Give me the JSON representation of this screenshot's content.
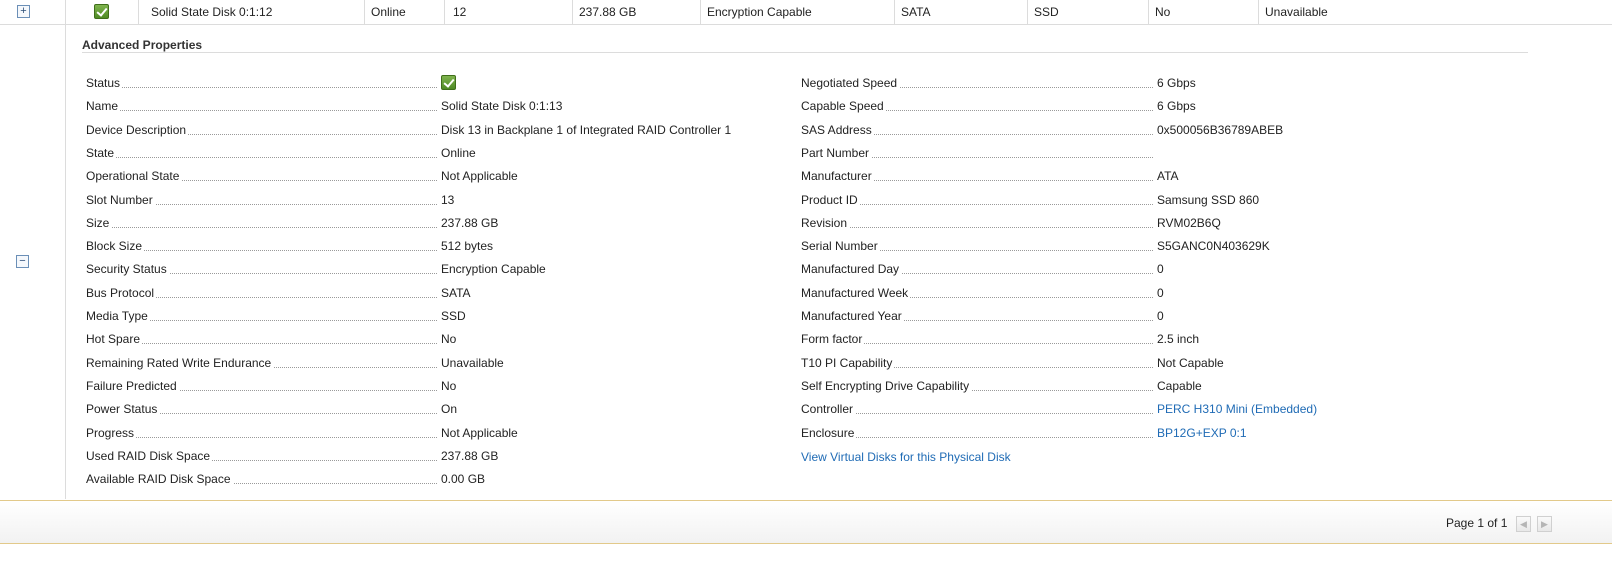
{
  "disk_row": {
    "expand_symbol": "+",
    "name": "Solid State Disk 0:1:12",
    "state": "Online",
    "slot": "12",
    "size": "237.88 GB",
    "security": "Encryption Capable",
    "bus": "SATA",
    "media": "SSD",
    "hot_spare": "No",
    "remaining_endurance": "Unavailable"
  },
  "collapse_symbol": "−",
  "advanced": {
    "title": "Advanced Properties",
    "left": [
      {
        "label": "Status",
        "value": "",
        "icon": "green-check-icon"
      },
      {
        "label": "Name",
        "value": "Solid State Disk 0:1:13"
      },
      {
        "label": "Device Description",
        "value": "Disk 13 in Backplane 1 of Integrated RAID Controller 1"
      },
      {
        "label": "State",
        "value": "Online"
      },
      {
        "label": "Operational State",
        "value": "Not Applicable"
      },
      {
        "label": "Slot Number",
        "value": "13"
      },
      {
        "label": "Size",
        "value": "237.88 GB"
      },
      {
        "label": "Block Size",
        "value": "512 bytes"
      },
      {
        "label": "Security Status",
        "value": "Encryption Capable"
      },
      {
        "label": "Bus Protocol",
        "value": "SATA"
      },
      {
        "label": "Media Type",
        "value": "SSD"
      },
      {
        "label": "Hot Spare",
        "value": "No"
      },
      {
        "label": "Remaining Rated Write Endurance",
        "value": "Unavailable"
      },
      {
        "label": "Failure Predicted",
        "value": "No"
      },
      {
        "label": "Power Status",
        "value": "On"
      },
      {
        "label": "Progress",
        "value": "Not Applicable"
      },
      {
        "label": "Used RAID Disk Space",
        "value": "237.88 GB"
      },
      {
        "label": "Available RAID Disk Space",
        "value": "0.00 GB"
      }
    ],
    "right": [
      {
        "label": "Negotiated Speed",
        "value": "6 Gbps"
      },
      {
        "label": "Capable Speed",
        "value": "6 Gbps"
      },
      {
        "label": "SAS Address",
        "value": "0x500056B36789ABEB"
      },
      {
        "label": "Part Number",
        "value": ""
      },
      {
        "label": "Manufacturer",
        "value": "ATA"
      },
      {
        "label": "Product ID",
        "value": "Samsung SSD 860"
      },
      {
        "label": "Revision",
        "value": "RVM02B6Q"
      },
      {
        "label": "Serial Number",
        "value": "S5GANC0N403629K"
      },
      {
        "label": "Manufactured Day",
        "value": "0"
      },
      {
        "label": "Manufactured Week",
        "value": "0"
      },
      {
        "label": "Manufactured Year",
        "value": "0"
      },
      {
        "label": "Form factor",
        "value": "2.5 inch"
      },
      {
        "label": "T10 PI Capability",
        "value": "Not Capable"
      },
      {
        "label": "Self Encrypting Drive Capability",
        "value": "Capable"
      },
      {
        "label": "Controller",
        "value": "PERC H310 Mini (Embedded)",
        "link": true
      },
      {
        "label": "Enclosure",
        "value": "BP12G+EXP 0:1",
        "link": true
      }
    ],
    "view_link": "View Virtual Disks for this Physical Disk"
  },
  "footer": {
    "page_info": "Page 1 of 1",
    "prev_symbol": "◀",
    "next_symbol": "▶"
  },
  "colors": {
    "link": "#1f6bb5",
    "status_ok": "#4f8a24"
  }
}
